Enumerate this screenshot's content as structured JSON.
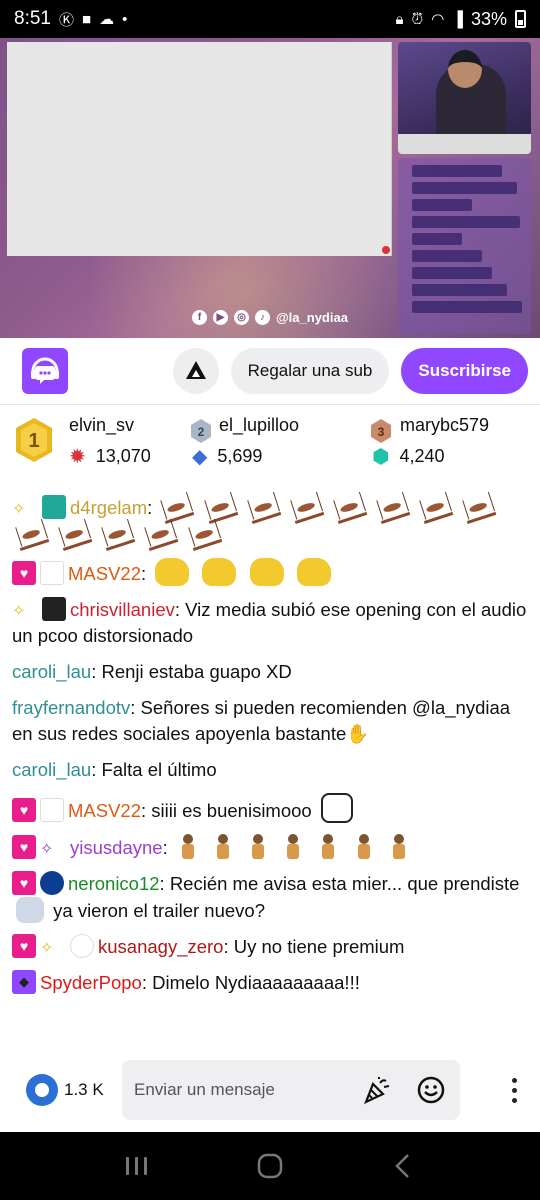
{
  "status_bar": {
    "time": "8:51",
    "battery": "33%"
  },
  "stream": {
    "social_handle": "@la_nydiaa"
  },
  "actions": {
    "gift_label": "Regalar una sub",
    "subscribe_label": "Suscribirse"
  },
  "leaderboard": [
    {
      "rank": "1",
      "name": "elvin_sv",
      "score": "13,070",
      "icon": "red-star-icon",
      "color": "#e0303a"
    },
    {
      "rank": "2",
      "name": "el_lupilloo",
      "score": "5,699",
      "icon": "blue-gem-icon",
      "color": "#3c6bdc"
    },
    {
      "rank": "3",
      "name": "marybc579",
      "score": "4,240",
      "icon": "teal-gem-icon",
      "color": "#1fc4a8"
    }
  ],
  "chat": [
    {
      "user": "d4rgelam",
      "color": "#c7a033",
      "text": ""
    },
    {
      "user": "MASV22",
      "color": "#e05a10",
      "text": ""
    },
    {
      "user": "chrisvillaniev",
      "color": "#d02030",
      "text": ": Viz media subió ese opening con el audio un pcoo distorsionado"
    },
    {
      "user": "caroli_lau",
      "color": "#2f8f93",
      "text": ": Renji estaba guapo XD"
    },
    {
      "user": "frayfernandotv",
      "color": "#2f8f93",
      "text": ": Señores si pueden recomienden @la_nydiaa  en sus redes sociales apoyenla bastante"
    },
    {
      "user": "caroli_lau",
      "color": "#2f8f93",
      "text": ": Falta el último"
    },
    {
      "user": "MASV22",
      "color": "#e05a10",
      "text": ": siiii es buenisimooo"
    },
    {
      "user": "yisusdayne",
      "color": "#9a3fd0",
      "text": ":"
    },
    {
      "user": "neronico12",
      "color": "#1a8a2a",
      "text_a": ": Recién me avisa esta mier... que prendiste",
      "text_b": "ya vieron el trailer nuevo?"
    },
    {
      "user": "kusanagy_zero",
      "color": "#b01818",
      "text": ": Uy no tiene premium"
    },
    {
      "user": "SpyderPopo",
      "color": "#e01818",
      "text": ": Dimelo Nydiaaaaaaaaa!!!"
    }
  ],
  "input": {
    "viewer_count": "1.3 K",
    "placeholder": "Enviar un mensaje"
  }
}
